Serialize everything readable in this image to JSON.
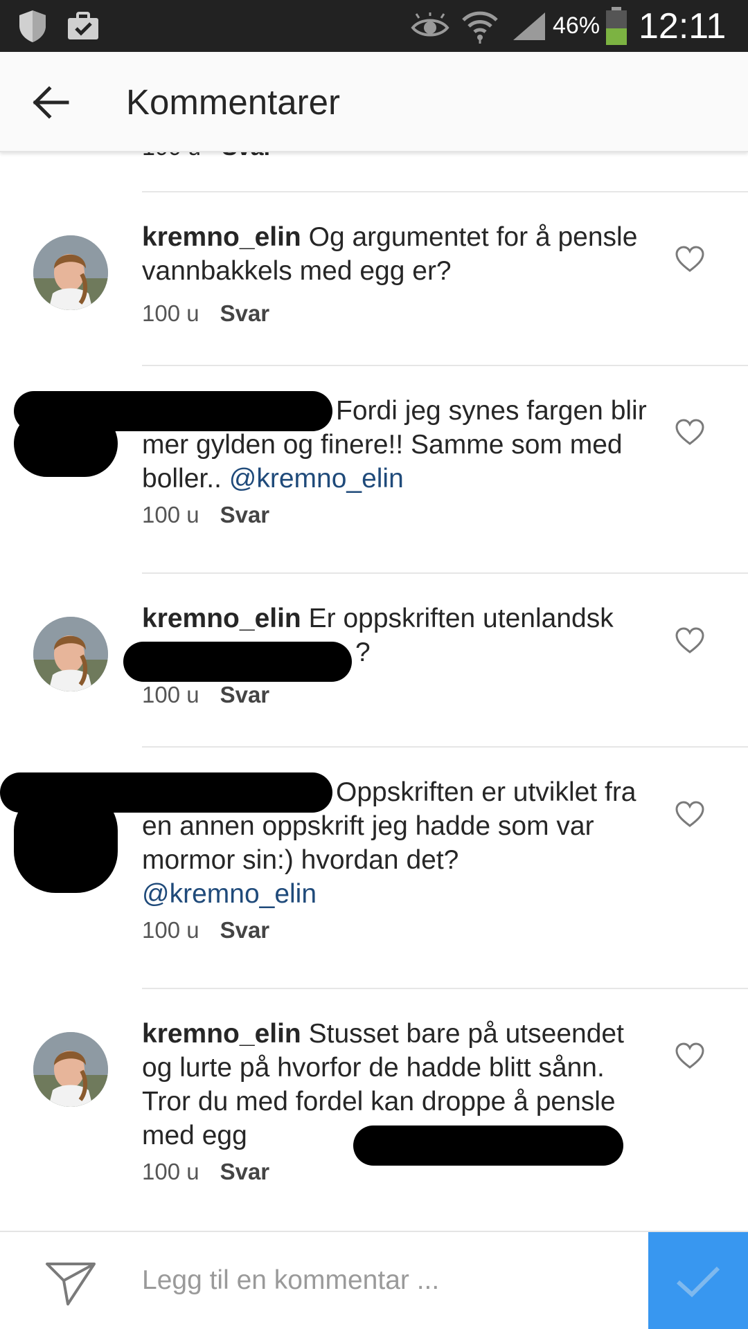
{
  "status_bar": {
    "battery_percent": "46%",
    "time": "12:11",
    "icons": [
      "shield-icon",
      "briefcase-check-icon",
      "eye-icon",
      "wifi-icon",
      "signal-icon",
      "battery-icon"
    ]
  },
  "header": {
    "title": "Kommentarer",
    "back_icon": "arrow-left-icon"
  },
  "partial_comment": {
    "time": "100 u",
    "reply": "Svar"
  },
  "comments": [
    {
      "username": "kremno_elin",
      "text": "Og argumentet for å pensle vannbakkels med egg er?",
      "time": "100 u",
      "reply": "Svar",
      "liked": false
    },
    {
      "username": "",
      "text": "Fordi jeg synes fargen blir mer gylden og finere!! Samme som med boller.. ",
      "mention": "@kremno_elin",
      "time": "100 u",
      "reply": "Svar",
      "liked": false
    },
    {
      "username": "kremno_elin",
      "text": "Er oppskriften utenlandsk",
      "text_after_redaction": "?",
      "time": "100 u",
      "reply": "Svar",
      "liked": false
    },
    {
      "username": "",
      "text": "Oppskriften er utviklet fra en annen oppskrift jeg hadde som var mormor sin:) hvordan det?",
      "mention": "@kremno_elin",
      "time": "100 u",
      "reply": "Svar",
      "liked": false
    },
    {
      "username": "kremno_elin",
      "text": "Stusset bare på utseendet og lurte på hvorfor de hadde blitt sånn. Tror du med fordel kan droppe å pensle med egg",
      "time": "100 u",
      "reply": "Svar",
      "liked": false
    }
  ],
  "composer": {
    "placeholder": "Legg til en kommentar ...",
    "value": "",
    "send_icon": "paper-plane-icon",
    "submit_icon": "checkmark-icon"
  },
  "colors": {
    "status_bar_bg": "#222222",
    "app_bar_bg": "#fafafa",
    "mention": "#1f4a7a",
    "submit_button": "#3897f0",
    "battery_fill": "#7cb342"
  }
}
